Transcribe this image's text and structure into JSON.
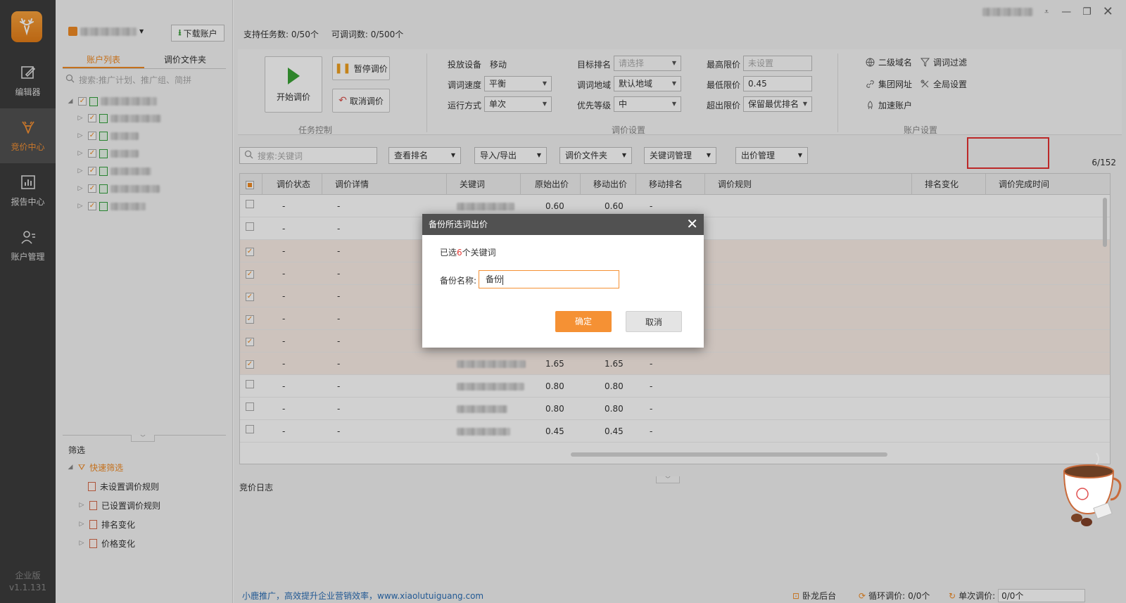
{
  "nav": {
    "items": [
      {
        "label": "编辑器",
        "icon": "edit-icon"
      },
      {
        "label": "竞价中心",
        "icon": "antler-icon"
      },
      {
        "label": "报告中心",
        "icon": "bar-chart-icon"
      },
      {
        "label": "账户管理",
        "icon": "user-manage-icon"
      }
    ],
    "edition": "企业版",
    "version": "v1.1.131"
  },
  "left": {
    "download_label": "下载账户",
    "tabs": [
      "账户列表",
      "调价文件夹"
    ],
    "search_placeholder": "搜索:推广计划、推广组、简拼",
    "filter_title": "筛选",
    "quick_filter": "快速筛选",
    "filters": [
      "未设置调价规则",
      "已设置调价规则",
      "排名变化",
      "价格变化"
    ]
  },
  "top": {
    "tasks_label": "支持任务数:",
    "tasks_value": "0/50个",
    "words_label": "可调词数:",
    "words_value": "0/500个"
  },
  "toolbox": {
    "start": "开始调价",
    "pause": "暂停调价",
    "cancel": "取消调价",
    "group_task": "任务控制",
    "group_price": "调价设置",
    "group_account": "账户设置",
    "device_label": "投放设备",
    "device_value": "移动",
    "speed_label": "调词速度",
    "speed_value": "平衡",
    "mode_label": "运行方式",
    "mode_value": "单次",
    "target_label": "目标排名",
    "target_value": "请选择",
    "region_label": "调词地域",
    "region_value": "默认地域",
    "priority_label": "优先等级",
    "priority_value": "中",
    "max_label": "最高限价",
    "max_value": "未设置",
    "min_label": "最低限价",
    "min_value": "0.45",
    "over_label": "超出限价",
    "over_value": "保留最优排名",
    "links": [
      "二级域名",
      "调词过滤",
      "集团网址",
      "全局设置",
      "加速账户"
    ]
  },
  "filterbar": {
    "search_placeholder": "搜索:关键词",
    "buttons": [
      "查看排名",
      "导入/导出",
      "调价文件夹",
      "关键词管理",
      "出价管理"
    ],
    "count": "6/152"
  },
  "table": {
    "headers": [
      "调价状态",
      "调价详情",
      "关键词",
      "原始出价",
      "移动出价",
      "移动排名",
      "调价规则",
      "排名变化",
      "调价完成时间"
    ],
    "rows": [
      {
        "checked": false,
        "status": "-",
        "detail": "-",
        "orig": "0.60",
        "mobile": "0.60",
        "rank": "-"
      },
      {
        "checked": false,
        "status": "-",
        "detail": "-",
        "orig": "",
        "mobile": "",
        "rank": ""
      },
      {
        "checked": true,
        "status": "-",
        "detail": "-",
        "orig": "",
        "mobile": "",
        "rank": ""
      },
      {
        "checked": true,
        "status": "-",
        "detail": "-",
        "orig": "",
        "mobile": "",
        "rank": ""
      },
      {
        "checked": true,
        "status": "-",
        "detail": "-",
        "orig": "",
        "mobile": "",
        "rank": ""
      },
      {
        "checked": true,
        "status": "-",
        "detail": "-",
        "orig": "",
        "mobile": "",
        "rank": ""
      },
      {
        "checked": true,
        "status": "-",
        "detail": "-",
        "orig": "",
        "mobile": "",
        "rank": ""
      },
      {
        "checked": true,
        "status": "-",
        "detail": "-",
        "orig": "1.65",
        "mobile": "1.65",
        "rank": "-"
      },
      {
        "checked": false,
        "status": "-",
        "detail": "-",
        "orig": "0.80",
        "mobile": "0.80",
        "rank": "-"
      },
      {
        "checked": false,
        "status": "-",
        "detail": "-",
        "orig": "0.80",
        "mobile": "0.80",
        "rank": "-"
      },
      {
        "checked": false,
        "status": "-",
        "detail": "-",
        "orig": "0.45",
        "mobile": "0.45",
        "rank": "-"
      }
    ]
  },
  "log_label": "竞价日志",
  "footer": {
    "slogan": "小鹿推广，高效提升企业营销效率，www.xiaolutuiguang.com",
    "backend": "卧龙后台",
    "loop_label": "循环调价:",
    "loop_value": "0/0个",
    "single_label": "单次调价:",
    "single_value": "0/0个"
  },
  "dialog": {
    "title": "备份所选词出价",
    "selected_prefix": "已选",
    "selected_count": "6",
    "selected_suffix": "个关键词",
    "name_label": "备份名称:",
    "name_value": "备份",
    "ok": "确定",
    "cancel": "取消"
  },
  "colors": {
    "accent": "#f59134",
    "nav_bg": "#3c3c3c",
    "highlight": "#e63131"
  }
}
